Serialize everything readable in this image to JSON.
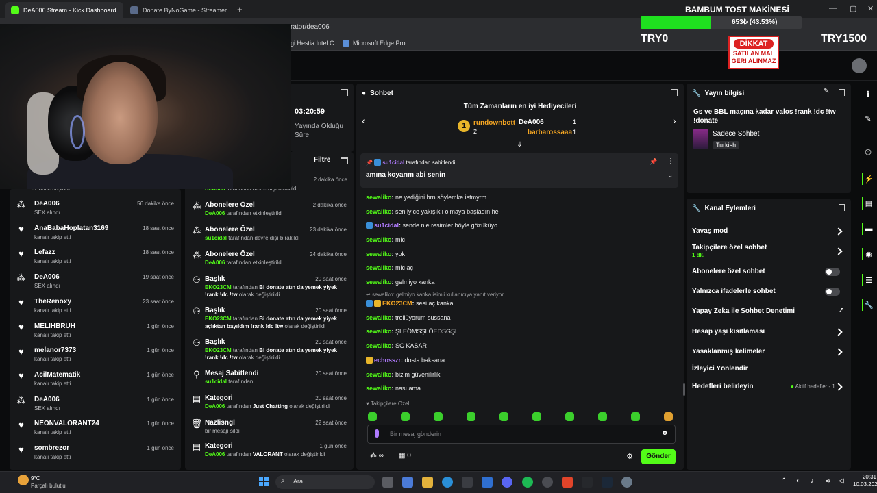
{
  "browser": {
    "tabs": [
      {
        "label": "DeA006 Stream - Kick Dashboard",
        "active": true
      },
      {
        "label": "Donate ByNoGame - Streamer Settin",
        "active": false
      }
    ],
    "url": "rator/dea006",
    "favorites": [
      "gi Hestia Intel C...",
      "Microsoft Edge Pro..."
    ]
  },
  "overlay": {
    "donation_title": "BAMBUM TOST MAKİNESİ",
    "donation_percent_text": "653₺ (43.53%)",
    "donation_progress": 0.4353,
    "goal_start": "TRY0",
    "goal_end": "TRY1500",
    "sign_top": "DİKKAT",
    "sign_line1": "SATILAN MAL",
    "sign_line2": "GERİ ALINMAZ"
  },
  "stats": {
    "time": "03:20:59",
    "time_label1": "Yayında Olduğu",
    "time_label2": "Süre"
  },
  "activity": {
    "first_partial": "az önce başladı",
    "items": [
      {
        "icon": "gift-icon",
        "name": "DeA006",
        "sub": "SEX alındı",
        "time": "56 dakika önce"
      },
      {
        "icon": "heart-icon",
        "name": "AnaBabaHoplatan3169",
        "sub": "kanalı takip etti",
        "time": "18 saat önce"
      },
      {
        "icon": "heart-icon",
        "name": "Lefazz",
        "sub": "kanalı takip etti",
        "time": "18 saat önce"
      },
      {
        "icon": "gift-icon",
        "name": "DeA006",
        "sub": "SEX alındı",
        "time": "19 saat önce"
      },
      {
        "icon": "heart-icon",
        "name": "TheRenoxy",
        "sub": "kanalı takip etti",
        "time": "23 saat önce"
      },
      {
        "icon": "heart-icon",
        "name": "MELIHBRUH",
        "sub": "kanalı takip etti",
        "time": "1 gün önce"
      },
      {
        "icon": "heart-icon",
        "name": "melanor7373",
        "sub": "kanalı takip etti",
        "time": "1 gün önce"
      },
      {
        "icon": "heart-icon",
        "name": "AcilMatematik",
        "sub": "kanalı takip etti",
        "time": "1 gün önce"
      },
      {
        "icon": "gift-icon",
        "name": "DeA006",
        "sub": "SEX alındı",
        "time": "1 gün önce"
      },
      {
        "icon": "heart-icon",
        "name": "NEONVALORANT24",
        "sub": "kanalı takip etti",
        "time": "1 gün önce"
      },
      {
        "icon": "heart-icon",
        "name": "sombrezor",
        "sub": "kanalı takip etti",
        "time": "1 gün önce"
      }
    ]
  },
  "modlog": {
    "filter_label": "Filtre",
    "first_partial_sub": "DeA006 tarafından devre dışı bırakıldı",
    "first_partial_time": "2 dakika önce",
    "items": [
      {
        "icon": "gift-icon",
        "title": "Abonelere Özel",
        "actor": "DeA006",
        "rest": "tarafından etkinleştirildi",
        "time": "2 dakika önce"
      },
      {
        "icon": "gift-icon",
        "title": "Abonelere Özel",
        "actor": "su1cidal",
        "rest": "tarafından devre dışı bırakıldı",
        "time": "23 dakika önce"
      },
      {
        "icon": "gift-icon",
        "title": "Abonelere Özel",
        "actor": "DeA006",
        "rest": "tarafından etkinleştirildi",
        "time": "24 dakika önce"
      },
      {
        "icon": "users-icon",
        "title": "Başlık",
        "actor": "EKO23CM",
        "rest": "tarafından",
        "bold": "Bi donate atın da yemek yiyek",
        "line2": "!rank !dc !tw",
        "line2rest": "olarak değiştirildi",
        "time": "20 saat önce"
      },
      {
        "icon": "users-icon",
        "title": "Başlık",
        "actor": "EKO23CM",
        "rest": "tarafından",
        "bold": "Bi donate atın da yemek yiyek",
        "line2": "açlıktan bayıldım !rank !dc !tw",
        "line2rest": "olarak değiştirildi",
        "time": "20 saat önce"
      },
      {
        "icon": "users-icon",
        "title": "Başlık",
        "actor": "EKO23CM",
        "rest": "tarafından",
        "bold": "Bi donate atın da yemek yiyek",
        "line2": "!rank !dc !tw",
        "line2rest": "olarak değiştirildi",
        "time": "20 saat önce"
      },
      {
        "icon": "pin-icon",
        "title": "Mesaj Sabitlendi",
        "actor": "su1cidal",
        "rest": "tarafından",
        "time": "20 saat önce"
      },
      {
        "icon": "category-icon",
        "title": "Kategori",
        "actor": "DeA006",
        "rest": "tarafından",
        "bold": "Just Chatting",
        "tail": "olarak değiştirildi",
        "time": "20 saat önce"
      },
      {
        "icon": "trash-icon",
        "title": "Nazlisngl",
        "actor": "",
        "rest": "bir mesajı sildi",
        "time": "22 saat önce"
      },
      {
        "icon": "category-icon",
        "title": "Kategori",
        "actor": "DeA006",
        "rest": "tarafından",
        "bold": "VALORANT",
        "tail": "olarak değiştirildi",
        "time": "1 gün önce"
      }
    ]
  },
  "chat": {
    "title": "Sohbet",
    "top_gifters_title": "Tüm Zamanların en iyi Hediyecileri",
    "gifters": [
      {
        "rank": "1",
        "name": "rundownbott",
        "count": "2"
      },
      {
        "rank": "",
        "name": "DeA006",
        "count": "1"
      },
      {
        "rank": "",
        "name": "barbarossaaa",
        "count": "1"
      }
    ],
    "pinned_by": "su1cidal",
    "pinned_by_rest": "tarafından sabitlendi",
    "pinned_message": "amına koyarım abi senin",
    "messages": [
      {
        "user": "sewaliko",
        "text": "ne yediğini brn söylemke istmyrm",
        "style": "g"
      },
      {
        "user": "sewaliko",
        "text": "sen iyice yakışıklı olmaya başladın he",
        "style": "g"
      },
      {
        "user": "su1cidal",
        "text": "sende nie resimler böyle gözüküyo",
        "style": "p"
      },
      {
        "user": "sewaliko",
        "text": "mic",
        "style": "g"
      },
      {
        "user": "sewaliko",
        "text": "yok",
        "style": "g"
      },
      {
        "user": "sewaliko",
        "text": "mic aç",
        "style": "g"
      },
      {
        "user": "sewaliko",
        "text": "gelmiyo kanka",
        "style": "g"
      },
      {
        "user": "EKO23CM",
        "text": "sesi aç kanka",
        "style": "g"
      },
      {
        "user": "sewaliko",
        "text": "trollüyorum sussana",
        "style": "g"
      },
      {
        "user": "sewaliko",
        "text": "ŞLEÖMSŞLÖEDSGŞL",
        "style": "g"
      },
      {
        "user": "sewaliko",
        "text": "SG KASAR",
        "style": "g"
      },
      {
        "user": "echosszr",
        "text": "dosta baksana",
        "style": "p"
      },
      {
        "user": "sewaliko",
        "text": "bizim güvenilirlik",
        "style": "g"
      },
      {
        "user": "sewaliko",
        "text": "nası ama",
        "style": "g"
      }
    ],
    "reply_to": "sewaliko: gelmiyo kanka isimli kullanıcıya yanıt veriyor",
    "followers_only": "Takipçilere Özel",
    "input_placeholder": "Bir mesaj gönderin",
    "viewer_count": "0",
    "send_label": "Gönder",
    "infinity": "∞"
  },
  "stream_info": {
    "title": "Yayın bilgisi",
    "stream_title": "Gs ve BBL maçına kadar valos !rank !dc !tw !donate",
    "category": "Sadece Sohbet",
    "language": "Turkish"
  },
  "channel_actions": {
    "title": "Kanal Eylemleri",
    "slow_mode": "Yavaş mod",
    "followers_chat": "Takipçilere özel sohbet",
    "followers_chat_sub": "1 dk.",
    "subs_chat": "Abonelere özel sohbet",
    "emote_chat": "Yalnızca ifadelerle sohbet",
    "ai_moderation": "Yapay Zeka ile Sohbet Denetimi",
    "account_age": "Hesap yaşı kısıtlaması",
    "banned_words": "Yasaklanmış kelimeler",
    "redirect": "İzleyici Yönlendir",
    "goals": "Hedefleri belirleyin",
    "goals_status": "Aktif hedefler - 1"
  },
  "taskbar": {
    "weather_temp": "9°C",
    "weather_desc": "Parçalı bulutlu",
    "search": "Ara",
    "time": "20:31",
    "date": "10.03.2026"
  },
  "colors": {
    "accent": "#53fc18",
    "panel": "#17181a",
    "bg": "#0b0c0d"
  }
}
